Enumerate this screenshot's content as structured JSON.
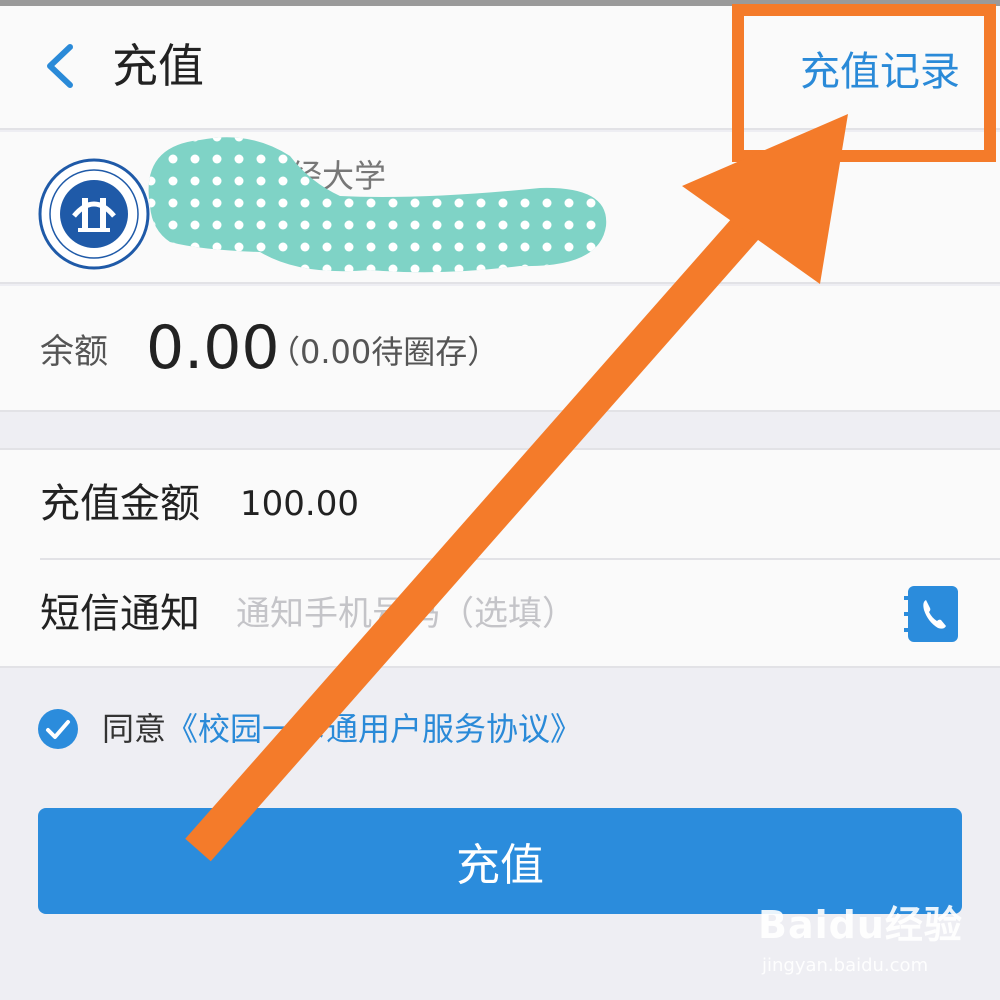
{
  "header": {
    "title": "充值",
    "records_link": "充值记录"
  },
  "school": {
    "name_visible": "经大学"
  },
  "balance": {
    "label": "余额",
    "value": "0.00",
    "pending": "（0.00待圈存）"
  },
  "form": {
    "amount_label": "充值金额",
    "amount_value": "100.00",
    "sms_label": "短信通知",
    "sms_placeholder": "通知手机号码（选填）"
  },
  "agreement": {
    "prefix": "同意",
    "link": "《校园一卡通用户服务协议》",
    "checked": true
  },
  "submit_label": "充值",
  "watermark": {
    "brand": "Baidu经验",
    "url": "jingyan.baidu.com"
  },
  "colors": {
    "accent": "#2b8cdc",
    "link": "#2a8ad8",
    "annotation": "#f47b2a",
    "redaction": "#7fd3c6"
  },
  "icons": {
    "back": "chevron-left-icon",
    "contact": "contact-book-icon",
    "check": "checkmark-circle-icon",
    "logo": "school-emblem-icon"
  }
}
